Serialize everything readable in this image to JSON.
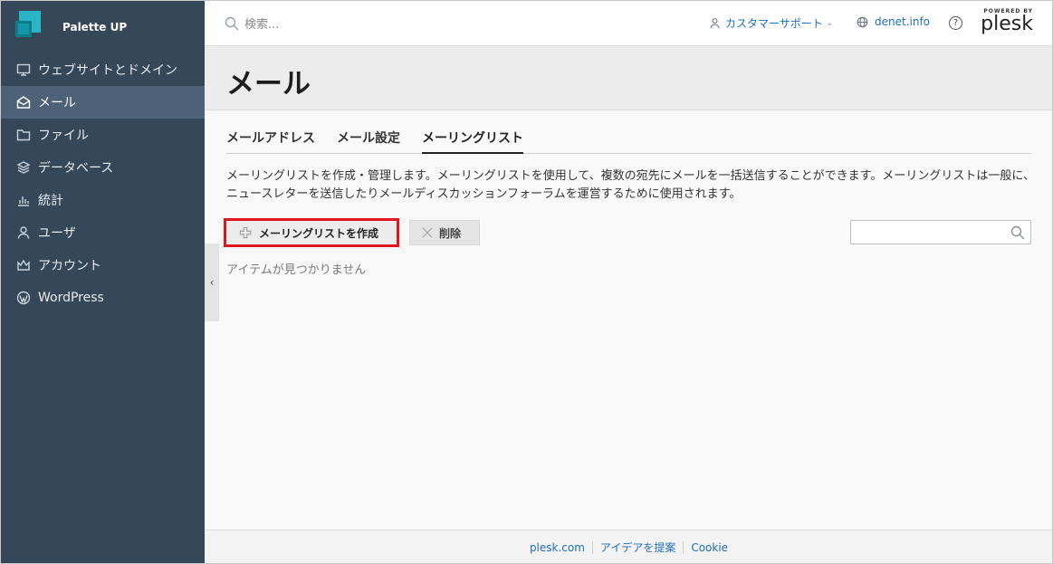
{
  "brand": {
    "name": "Palette UP"
  },
  "sidebar": {
    "items": [
      {
        "label": "ウェブサイトとドメイン",
        "icon": "monitor-icon"
      },
      {
        "label": "メール",
        "icon": "mail-icon",
        "active": true
      },
      {
        "label": "ファイル",
        "icon": "folder-icon"
      },
      {
        "label": "データベース",
        "icon": "database-icon"
      },
      {
        "label": "統計",
        "icon": "chart-icon"
      },
      {
        "label": "ユーザ",
        "icon": "user-icon"
      },
      {
        "label": "アカウント",
        "icon": "crown-icon"
      },
      {
        "label": "WordPress",
        "icon": "wordpress-icon"
      }
    ],
    "collapse_glyph": "‹"
  },
  "header": {
    "search_placeholder": "検索...",
    "support_label": "カスタマーサポート",
    "domain_label": "denet.info",
    "help_glyph": "?",
    "powered_by": "POWERED BY",
    "plesk_logo": "plesk"
  },
  "page": {
    "title": "メール",
    "tabs": [
      {
        "label": "メールアドレス"
      },
      {
        "label": "メール設定"
      },
      {
        "label": "メーリングリスト",
        "active": true
      }
    ],
    "description": "メーリングリストを作成・管理します。メーリングリストを使用して、複数の宛先にメールを一括送信することができます。メーリングリストは一般に、ニュースレターを送信したりメールディスカッションフォーラムを運営するために使用されます。",
    "create_button": "メーリングリストを作成",
    "delete_button": "削除",
    "empty_text": "アイテムが見つかりません"
  },
  "footer": {
    "links": [
      "plesk.com",
      "アイデアを提案",
      "Cookie"
    ]
  },
  "colors": {
    "sidebar_bg": "#37475a",
    "sidebar_active": "#4d6277",
    "link": "#1e6fb8",
    "highlight": "#e0161f"
  }
}
